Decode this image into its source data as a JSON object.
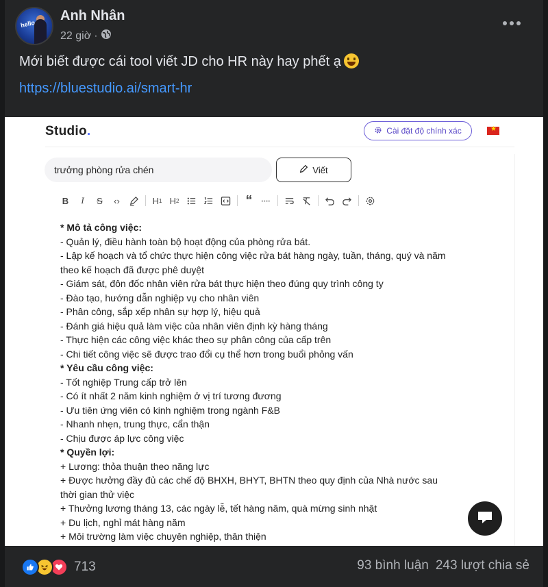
{
  "post": {
    "author": "Anh Nhân",
    "time": "22 giờ",
    "separator": "·",
    "text": "Mới biết được cái tool viết JD cho HR này hay phết ạ",
    "link": "https://bluestudio.ai/smart-hr"
  },
  "app": {
    "logo": "Studio",
    "logo_dot": ".",
    "accuracy_button": "Cài đặt độ chính xác",
    "query": "trưởng phòng rửa chén",
    "write_button": "Viết",
    "toolbar": [
      "bold-icon",
      "italic-icon",
      "strikethrough-icon",
      "code-icon",
      "highlighter-icon",
      "heading1-icon",
      "heading2-icon",
      "bullet-list-icon",
      "ordered-list-icon",
      "code-block-icon",
      "quote-icon",
      "horizontal-rule-icon",
      "wrap-icon",
      "clear-format-icon",
      "undo-icon",
      "redo-icon",
      "settings-icon"
    ],
    "content": [
      {
        "text": "* Mô tả công việc:",
        "bold": true
      },
      {
        "text": "- Quản lý, điều hành toàn bộ hoạt động của phòng rửa bát.",
        "bold": false
      },
      {
        "text": "- Lập kế hoạch và tổ chức thực hiện công việc rửa bát hàng ngày, tuần, tháng, quý và năm",
        "bold": false
      },
      {
        "text": "theo kế hoạch đã được phê duyệt",
        "bold": false
      },
      {
        "text": "- Giám sát, đôn đốc nhân viên rửa bát thực hiện theo đúng quy trình công ty",
        "bold": false
      },
      {
        "text": "- Đào tạo, hướng dẫn nghiệp vụ cho nhân viên",
        "bold": false
      },
      {
        "text": "- Phân công, sắp xếp nhân sự hợp lý, hiệu quả",
        "bold": false
      },
      {
        "text": "- Đánh giá hiệu quả làm việc của nhân viên định kỳ hàng tháng",
        "bold": false
      },
      {
        "text": "- Thực hiện các công việc khác theo sự phân công của cấp trên",
        "bold": false
      },
      {
        "text": "- Chi tiết công việc sẽ được trao đổi cụ thể hơn trong buổi phỏng vấn",
        "bold": false
      },
      {
        "text": "* Yêu cầu công việc:",
        "bold": true
      },
      {
        "text": "- Tốt nghiệp Trung cấp trở lên",
        "bold": false
      },
      {
        "text": "- Có ít nhất 2 năm kinh nghiệm ở vị trí tương đương",
        "bold": false
      },
      {
        "text": "- Ưu tiên ứng viên có kinh nghiệm trong ngành F&B",
        "bold": false
      },
      {
        "text": "- Nhanh nhẹn, trung thực, cẩn thận",
        "bold": false
      },
      {
        "text": "- Chịu được áp lực công việc",
        "bold": false
      },
      {
        "text": "* Quyền lợi:",
        "bold": true
      },
      {
        "text": "+ Lương: thỏa thuận theo năng lực",
        "bold": false
      },
      {
        "text": "+ Được hưởng đầy đủ các chế độ BHXH, BHYT, BHTN theo quy định của Nhà nước sau",
        "bold": false
      },
      {
        "text": "thời gian thử việc",
        "bold": false
      },
      {
        "text": "+ Thưởng lương tháng 13, các ngày lễ, tết hàng năm, quà mừng sinh nhật",
        "bold": false
      },
      {
        "text": "+ Du lịch, nghỉ mát hàng năm",
        "bold": false
      },
      {
        "text": "+ Môi trường làm việc chuyên nghiệp, thân thiện",
        "bold": false
      }
    ]
  },
  "footer": {
    "reaction_count": "713",
    "comments": "93 bình luận",
    "shares": "243 lượt chia sẻ"
  },
  "colors": {
    "background": "#18191a",
    "card": "#242526",
    "link": "#4599ff",
    "accent": "#5a48c8"
  }
}
